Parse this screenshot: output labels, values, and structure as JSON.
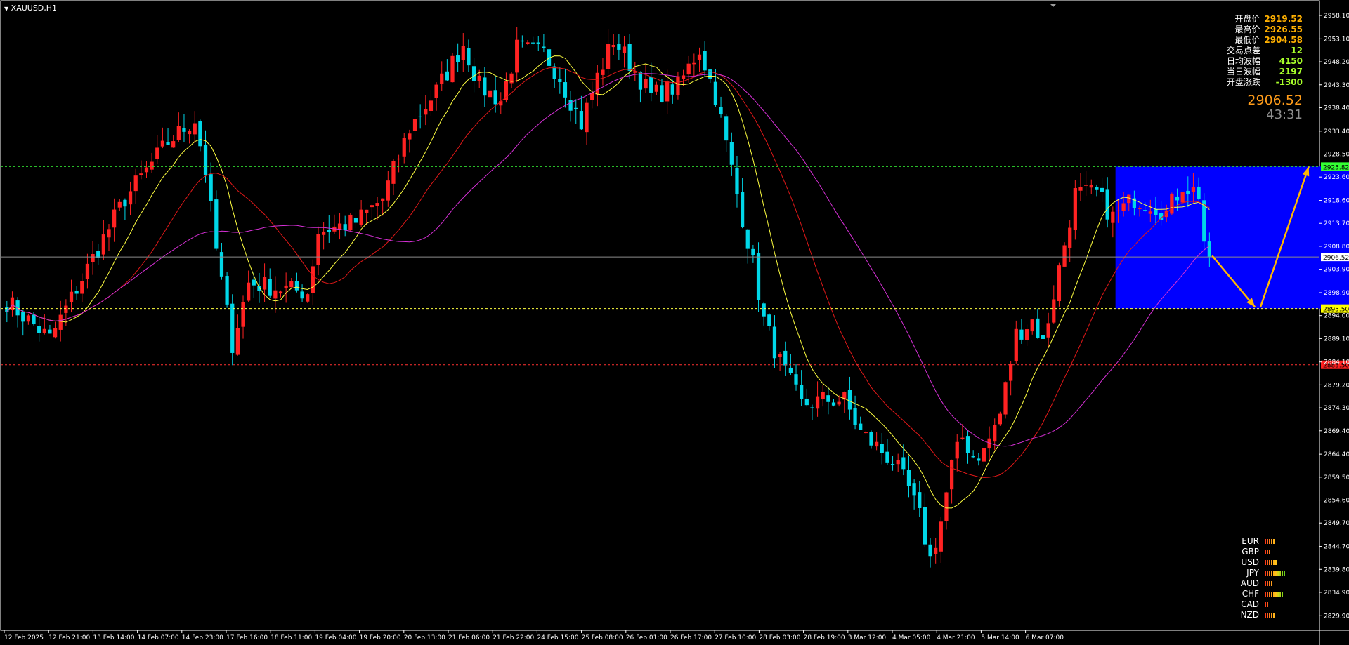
{
  "chart_title": "XAUUSD,H1",
  "info_panel": [
    {
      "label": "开盘价",
      "value": "2919.52",
      "color": "#ffb000"
    },
    {
      "label": "最高价",
      "value": "2926.55",
      "color": "#ffb000"
    },
    {
      "label": "最低价",
      "value": "2904.58",
      "color": "#ffb000"
    },
    {
      "label": "交易点差",
      "value": "12",
      "color": "#a8ff2a"
    },
    {
      "label": "日均波幅",
      "value": "4150",
      "color": "#a8ff2a"
    },
    {
      "label": "当日波幅",
      "value": "2197",
      "color": "#a8ff2a"
    },
    {
      "label": "开盘涨跌",
      "value": "-1300",
      "color": "#a8ff2a"
    }
  ],
  "current_price": "2906.52",
  "timer": "43:31",
  "currency_strength": [
    {
      "name": "EUR",
      "level": 5,
      "colors": [
        "#ff3b1a",
        "#ff5a1a",
        "#ff7a1a",
        "#ff9c1a",
        "#ffb31a"
      ]
    },
    {
      "name": "GBP",
      "level": 3,
      "colors": [
        "#ff3b1a",
        "#ff5a1a",
        "#ff7a1a"
      ]
    },
    {
      "name": "USD",
      "level": 6,
      "colors": [
        "#ff3b1a",
        "#ff5a1a",
        "#ff7a1a",
        "#ff9c1a",
        "#ffb31a",
        "#ffc21a"
      ]
    },
    {
      "name": "JPY",
      "level": 10,
      "colors": [
        "#ff3b1a",
        "#ff5a1a",
        "#ff7a1a",
        "#ff9c1a",
        "#ffb31a",
        "#ffc21a",
        "#d4d41a",
        "#b0d41a",
        "#8cd41a",
        "#6ad41a"
      ]
    },
    {
      "name": "AUD",
      "level": 4,
      "colors": [
        "#ff3b1a",
        "#ff5a1a",
        "#ff7a1a",
        "#ff9c1a"
      ]
    },
    {
      "name": "CHF",
      "level": 9,
      "colors": [
        "#ff3b1a",
        "#ff5a1a",
        "#ff7a1a",
        "#ff9c1a",
        "#ffb31a",
        "#ffc21a",
        "#d4d41a",
        "#b0d41a",
        "#8cd41a"
      ]
    },
    {
      "name": "CAD",
      "level": 2,
      "colors": [
        "#ff3b1a",
        "#ff5a1a"
      ]
    },
    {
      "name": "NZD",
      "level": 5,
      "colors": [
        "#ff3b1a",
        "#ff5a1a",
        "#ff7a1a",
        "#ff9c1a",
        "#ffb31a"
      ]
    }
  ],
  "chart_data": {
    "type": "candlestick",
    "symbol": "XAUUSD",
    "timeframe": "H1",
    "ylim": [
      2826.8,
      2961.1
    ],
    "y_ticks": [
      "2958.10",
      "2953.10",
      "2948.20",
      "2943.30",
      "2938.40",
      "2933.40",
      "2928.50",
      "2923.60",
      "2918.60",
      "2913.70",
      "2908.80",
      "2903.90",
      "2898.90",
      "2894.00",
      "2889.10",
      "2884.10",
      "2879.20",
      "2874.30",
      "2869.40",
      "2864.40",
      "2859.50",
      "2854.60",
      "2849.70",
      "2844.70",
      "2839.80",
      "2834.90",
      "2829.90"
    ],
    "x_ticks": [
      "12 Feb 2025",
      "12 Feb 21:00",
      "13 Feb 14:00",
      "14 Feb 07:00",
      "14 Feb 23:00",
      "17 Feb 16:00",
      "18 Feb 11:00",
      "19 Feb 04:00",
      "19 Feb 20:00",
      "20 Feb 13:00",
      "21 Feb 06:00",
      "21 Feb 22:00",
      "24 Feb 15:00",
      "25 Feb 08:00",
      "26 Feb 01:00",
      "26 Feb 17:00",
      "27 Feb 10:00",
      "28 Feb 03:00",
      "28 Feb 19:00",
      "3 Mar 12:00",
      "4 Mar 05:00",
      "4 Mar 21:00",
      "5 Mar 14:00",
      "6 Mar 07:00"
    ],
    "path_close": [
      [
        0,
        2897
      ],
      [
        8,
        2889
      ],
      [
        14,
        2902
      ],
      [
        22,
        2919
      ],
      [
        30,
        2931
      ],
      [
        35,
        2936
      ],
      [
        37,
        2925
      ],
      [
        39,
        2908
      ],
      [
        42,
        2888
      ],
      [
        45,
        2901
      ],
      [
        50,
        2900
      ],
      [
        56,
        2899
      ],
      [
        58,
        2912
      ],
      [
        65,
        2914
      ],
      [
        70,
        2919
      ],
      [
        75,
        2934
      ],
      [
        80,
        2942
      ],
      [
        85,
        2952
      ],
      [
        88,
        2943
      ],
      [
        92,
        2940
      ],
      [
        95,
        2951
      ],
      [
        100,
        2950
      ],
      [
        103,
        2945
      ],
      [
        107,
        2935
      ],
      [
        110,
        2945
      ],
      [
        113,
        2953
      ],
      [
        116,
        2948
      ],
      [
        120,
        2941
      ],
      [
        125,
        2943
      ],
      [
        129,
        2951
      ],
      [
        132,
        2941
      ],
      [
        136,
        2920
      ],
      [
        139,
        2905
      ],
      [
        141,
        2893
      ],
      [
        144,
        2884
      ],
      [
        148,
        2875
      ],
      [
        152,
        2876
      ],
      [
        156,
        2876
      ],
      [
        159,
        2869
      ],
      [
        162,
        2866
      ],
      [
        165,
        2863
      ],
      [
        168,
        2857
      ],
      [
        170,
        2851
      ],
      [
        172,
        2842
      ],
      [
        174,
        2850
      ],
      [
        176,
        2862
      ],
      [
        178,
        2868
      ],
      [
        180,
        2864
      ],
      [
        182,
        2865
      ],
      [
        185,
        2873
      ],
      [
        188,
        2890
      ],
      [
        191,
        2893
      ],
      [
        193,
        2888
      ],
      [
        196,
        2904
      ],
      [
        199,
        2920
      ],
      [
        203,
        2920
      ],
      [
        206,
        2915
      ],
      [
        210,
        2919
      ],
      [
        213,
        2918
      ],
      [
        216,
        2916
      ],
      [
        219,
        2922
      ],
      [
        222,
        2920
      ],
      [
        223,
        2910
      ],
      [
        224,
        2906
      ]
    ],
    "levels": [
      {
        "label": "2925.82",
        "value": 2925.82,
        "color": "#2fd62f",
        "style": "dashed",
        "tag_bg": "#33ff33",
        "tag_fg": "#000000"
      },
      {
        "label": "2906.52",
        "value": 2906.52,
        "color": "#8c8c8c",
        "style": "solid",
        "tag_bg": "#ffffff",
        "tag_fg": "#000000"
      },
      {
        "label": "2895.50",
        "value": 2895.5,
        "color": "#ffff40",
        "style": "dashed",
        "tag_bg": "#ffff00",
        "tag_fg": "#000000"
      },
      {
        "label": "2883.50",
        "value": 2883.5,
        "color": "#ff3030",
        "style": "dashed",
        "tag_bg": "#ff2020",
        "tag_fg": "#000000"
      }
    ],
    "zone": {
      "top": 2925.82,
      "bottom": 2895.5,
      "bar_from": 207,
      "bar_to": 274,
      "color": "#0000ff"
    },
    "arrows": [
      {
        "from": [
          225,
          2906.8
        ],
        "to": [
          233,
          2895.8
        ],
        "color": "#ffb800"
      },
      {
        "from": [
          234,
          2895.8
        ],
        "to": [
          243,
          2925.8
        ],
        "color": "#ffb800"
      }
    ],
    "indicators": [
      {
        "name": "MA fast",
        "color": "#ffff40"
      },
      {
        "name": "MA mid",
        "color": "#e01818"
      },
      {
        "name": "MA slow",
        "color": "#d630d6"
      }
    ],
    "colors": {
      "bull": "#ff2222",
      "bear": "#00d7e8",
      "grid_text": "#ffffff"
    }
  }
}
